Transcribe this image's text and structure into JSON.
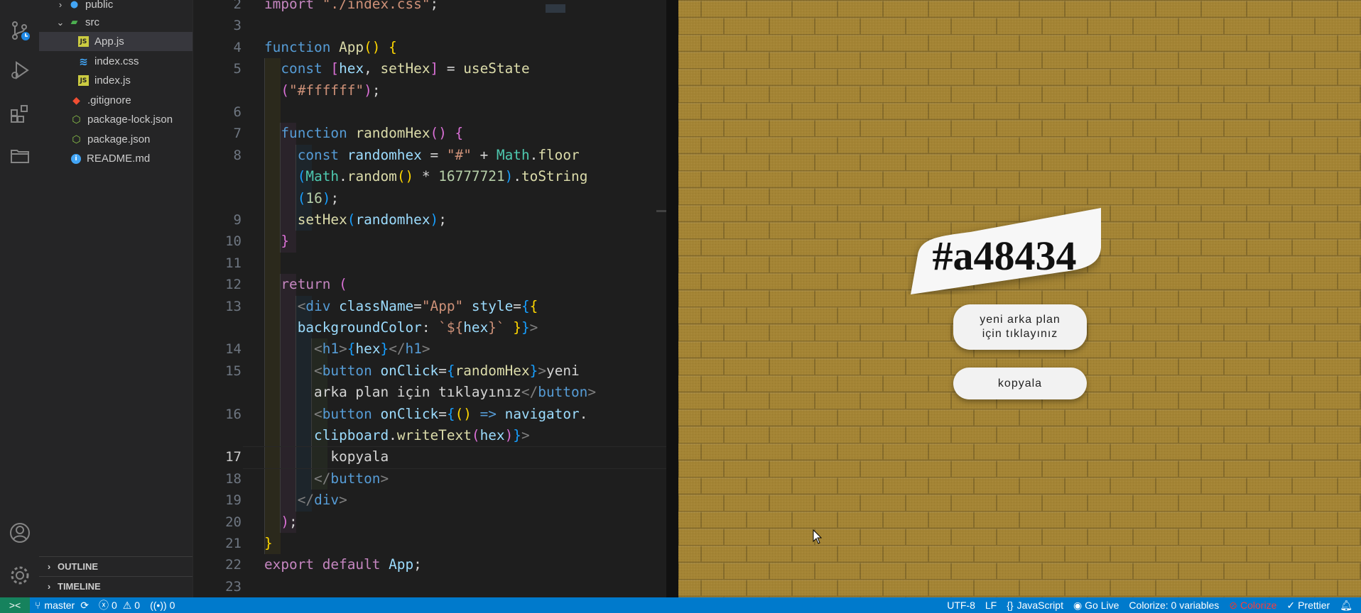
{
  "explorer": {
    "items": [
      {
        "label": "public",
        "kind": "folder",
        "open": false,
        "icon": "globe-folder-icon"
      },
      {
        "label": "src",
        "kind": "folder",
        "open": true,
        "icon": "src-folder-icon"
      },
      {
        "label": "App.js",
        "kind": "file",
        "icon": "js-file-icon",
        "badge": "JS",
        "color": "#cbcb41",
        "selected": true
      },
      {
        "label": "index.css",
        "kind": "file",
        "icon": "css-file-icon",
        "badge": "≋",
        "color": "#42a5f5"
      },
      {
        "label": "index.js",
        "kind": "file",
        "icon": "js-file-icon",
        "badge": "JS",
        "color": "#cbcb41"
      },
      {
        "label": ".gitignore",
        "kind": "file",
        "icon": "git-file-icon",
        "badge": "◆",
        "color": "#f14e32"
      },
      {
        "label": "package-lock.json",
        "kind": "file",
        "icon": "npm-file-icon",
        "badge": "⬡",
        "color": "#8bc34a"
      },
      {
        "label": "package.json",
        "kind": "file",
        "icon": "npm-file-icon",
        "badge": "⬡",
        "color": "#8bc34a"
      },
      {
        "label": "README.md",
        "kind": "file",
        "icon": "info-file-icon",
        "badge": "i",
        "color": "#42a5f5"
      }
    ],
    "outline_label": "OUTLINE",
    "timeline_label": "TIMELINE"
  },
  "editor": {
    "active_line": "17",
    "lines": [
      {
        "n": "2",
        "code": [
          [
            "kw",
            "import "
          ],
          [
            "st",
            "\"./index.css\""
          ],
          [
            "",
            "; "
          ]
        ]
      },
      {
        "n": "3",
        "code": []
      },
      {
        "n": "4",
        "code": [
          [
            "kb",
            "function "
          ],
          [
            "fn",
            "App"
          ],
          [
            "p1",
            "() {"
          ]
        ]
      },
      {
        "n": "5",
        "code": [
          [
            "",
            "  "
          ],
          [
            "kb",
            "const "
          ],
          [
            "p2",
            "["
          ],
          [
            "vr",
            "hex"
          ],
          [
            "",
            ", "
          ],
          [
            "fn",
            "setHex"
          ],
          [
            "p2",
            "]"
          ],
          [
            "",
            " = "
          ],
          [
            "fn",
            "useState"
          ]
        ]
      },
      {
        "n": "",
        "code": [
          [
            "",
            "  "
          ],
          [
            "p2",
            "("
          ],
          [
            "st",
            "\"#ffffff\""
          ],
          [
            "p2",
            ")"
          ],
          [
            "",
            ";"
          ]
        ]
      },
      {
        "n": "6",
        "code": []
      },
      {
        "n": "7",
        "code": [
          [
            "",
            "  "
          ],
          [
            "kb",
            "function "
          ],
          [
            "fn",
            "randomHex"
          ],
          [
            "p2",
            "() {"
          ]
        ]
      },
      {
        "n": "8",
        "code": [
          [
            "",
            "    "
          ],
          [
            "kb",
            "const "
          ],
          [
            "vr",
            "randomhex"
          ],
          [
            "",
            " = "
          ],
          [
            "st",
            "\"#\""
          ],
          [
            "",
            " + "
          ],
          [
            "ty",
            "Math"
          ],
          [
            "",
            "."
          ],
          [
            "fn",
            "floor"
          ]
        ]
      },
      {
        "n": "",
        "code": [
          [
            "",
            "    "
          ],
          [
            "p3",
            "("
          ],
          [
            "ty",
            "Math"
          ],
          [
            "",
            "."
          ],
          [
            "fn",
            "random"
          ],
          [
            "p1",
            "()"
          ],
          [
            "",
            " * "
          ],
          [
            "nm",
            "16777721"
          ],
          [
            "p3",
            ")"
          ],
          [
            "",
            "."
          ],
          [
            "fn",
            "toString"
          ]
        ]
      },
      {
        "n": "",
        "code": [
          [
            "",
            "    "
          ],
          [
            "p3",
            "("
          ],
          [
            "nm",
            "16"
          ],
          [
            "p3",
            ")"
          ],
          [
            "",
            ";"
          ]
        ]
      },
      {
        "n": "9",
        "code": [
          [
            "",
            "    "
          ],
          [
            "fn",
            "setHex"
          ],
          [
            "p3",
            "("
          ],
          [
            "vr",
            "randomhex"
          ],
          [
            "p3",
            ")"
          ],
          [
            "",
            ";"
          ]
        ]
      },
      {
        "n": "10",
        "code": [
          [
            "",
            "  "
          ],
          [
            "p2",
            "}"
          ]
        ]
      },
      {
        "n": "11",
        "code": []
      },
      {
        "n": "12",
        "code": [
          [
            "",
            "  "
          ],
          [
            "kw",
            "return "
          ],
          [
            "p2",
            "("
          ]
        ]
      },
      {
        "n": "13",
        "code": [
          [
            "",
            "    "
          ],
          [
            "gr",
            "<"
          ],
          [
            "tg",
            "div "
          ],
          [
            "at",
            "className"
          ],
          [
            "",
            "="
          ],
          [
            "st",
            "\"App\" "
          ],
          [
            "at",
            "style"
          ],
          [
            "",
            "="
          ],
          [
            "p3",
            "{"
          ],
          [
            "p1",
            "{"
          ]
        ]
      },
      {
        "n": "",
        "code": [
          [
            "",
            "    "
          ],
          [
            "vr",
            "backgroundColor"
          ],
          [
            "",
            ": "
          ],
          [
            "st",
            "`${"
          ],
          [
            "vr",
            "hex"
          ],
          [
            "st",
            "}`"
          ],
          [
            "p1",
            " }"
          ],
          [
            "p3",
            "}"
          ],
          [
            "gr",
            ">"
          ]
        ]
      },
      {
        "n": "14",
        "code": [
          [
            "",
            "      "
          ],
          [
            "gr",
            "<"
          ],
          [
            "tg",
            "h1"
          ],
          [
            "gr",
            ">"
          ],
          [
            "p3",
            "{"
          ],
          [
            "vr",
            "hex"
          ],
          [
            "p3",
            "}"
          ],
          [
            "gr",
            "</"
          ],
          [
            "tg",
            "h1"
          ],
          [
            "gr",
            ">"
          ]
        ]
      },
      {
        "n": "15",
        "code": [
          [
            "",
            "      "
          ],
          [
            "gr",
            "<"
          ],
          [
            "tg",
            "button "
          ],
          [
            "at",
            "onClick"
          ],
          [
            "",
            "="
          ],
          [
            "p3",
            "{"
          ],
          [
            "fn",
            "randomHex"
          ],
          [
            "p3",
            "}"
          ],
          [
            "gr",
            ">"
          ],
          [
            "",
            "yeni"
          ]
        ]
      },
      {
        "n": "",
        "code": [
          [
            "",
            "      arka plan için tıklayınız"
          ],
          [
            "gr",
            "</"
          ],
          [
            "tg",
            "button"
          ],
          [
            "gr",
            ">"
          ]
        ]
      },
      {
        "n": "16",
        "code": [
          [
            "",
            "      "
          ],
          [
            "gr",
            "<"
          ],
          [
            "tg",
            "button "
          ],
          [
            "at",
            "onClick"
          ],
          [
            "",
            "="
          ],
          [
            "p3",
            "{"
          ],
          [
            "p1",
            "() "
          ],
          [
            "kb",
            "=> "
          ],
          [
            "vr",
            "navigator"
          ],
          [
            "",
            "."
          ]
        ]
      },
      {
        "n": "",
        "code": [
          [
            "",
            "      "
          ],
          [
            "vr",
            "clipboard"
          ],
          [
            "",
            "."
          ],
          [
            "fn",
            "writeText"
          ],
          [
            "p2",
            "("
          ],
          [
            "vr",
            "hex"
          ],
          [
            "p2",
            ")"
          ],
          [
            "p3",
            "}"
          ],
          [
            "gr",
            ">"
          ]
        ]
      },
      {
        "n": "17",
        "code": [
          [
            "",
            "        kopyala"
          ]
        ]
      },
      {
        "n": "18",
        "code": [
          [
            "",
            "      "
          ],
          [
            "gr",
            "</"
          ],
          [
            "tg",
            "button"
          ],
          [
            "gr",
            ">"
          ]
        ]
      },
      {
        "n": "19",
        "code": [
          [
            "",
            "    "
          ],
          [
            "gr",
            "</"
          ],
          [
            "tg",
            "div"
          ],
          [
            "gr",
            ">"
          ]
        ]
      },
      {
        "n": "20",
        "code": [
          [
            "",
            "  "
          ],
          [
            "p2",
            ")"
          ],
          [
            "",
            ";"
          ]
        ]
      },
      {
        "n": "21",
        "code": [
          [
            "p1",
            "}"
          ]
        ]
      },
      {
        "n": "22",
        "code": [
          [
            "kw",
            "export default "
          ],
          [
            "vr",
            "App"
          ],
          [
            "",
            ";"
          ]
        ]
      },
      {
        "n": "23",
        "code": []
      }
    ]
  },
  "preview": {
    "background": "#a48434",
    "hex_title": "#a48434",
    "new_bg_button": "yeni arka plan için tıklayınız",
    "copy_button": "kopyala"
  },
  "statusbar": {
    "branch": "master",
    "errors": "0",
    "warnings": "0",
    "ports": "0",
    "encoding": "UTF-8",
    "eol": "LF",
    "language": "JavaScript",
    "golive": "Go Live",
    "colorize_vars": "Colorize: 0 variables",
    "colorize": "Colorize",
    "prettier": "Prettier"
  },
  "colors": {
    "accent": "#007acc",
    "remote": "#16825d",
    "preview_bg": "#a48434"
  }
}
